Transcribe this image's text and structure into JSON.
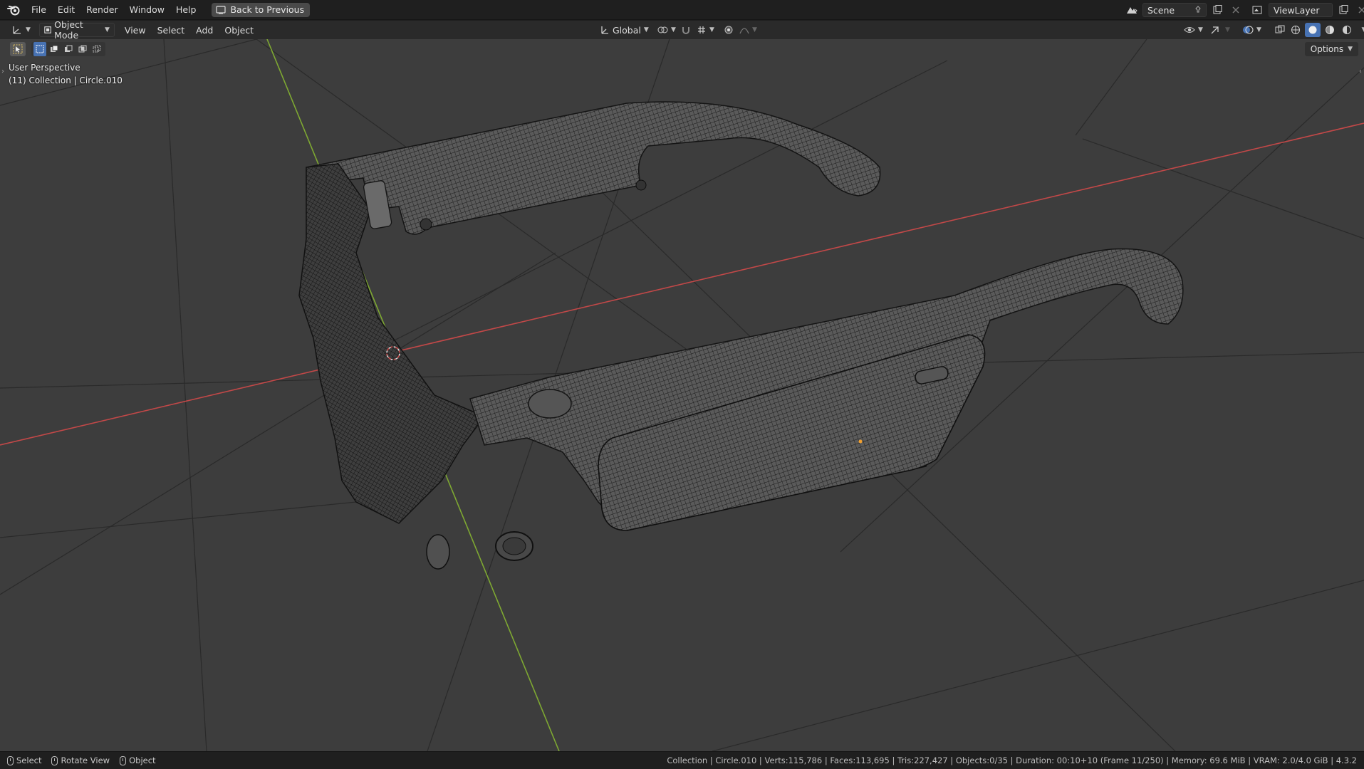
{
  "menubar": {
    "items": [
      "File",
      "Edit",
      "Render",
      "Window",
      "Help"
    ],
    "back_button": "Back to Previous",
    "scene": "Scene",
    "view_layer": "ViewLayer"
  },
  "viewport_header": {
    "mode": "Object Mode",
    "menus": [
      "View",
      "Select",
      "Add",
      "Object"
    ],
    "transform_orientation": "Global"
  },
  "viewport": {
    "perspective_label": "User Perspective",
    "collection_label": "(11) Collection | Circle.010",
    "options_label": "Options"
  },
  "statusbar": {
    "hints": [
      {
        "label": "Select"
      },
      {
        "label": "Rotate View"
      },
      {
        "label": "Object"
      }
    ],
    "stats": "Collection | Circle.010 | Verts:115,786 | Faces:113,695 | Tris:227,427 | Objects:0/35 | Duration: 00:10+10 (Frame 11/250) | Memory: 69.6 MiB | VRAM: 2.0/4.0 GiB | 4.3.2"
  },
  "colors": {
    "viewport_bg": "#3d3d3d",
    "x_axis": "#d04a4a",
    "y_axis": "#7ea832",
    "accent": "#4772b3"
  }
}
